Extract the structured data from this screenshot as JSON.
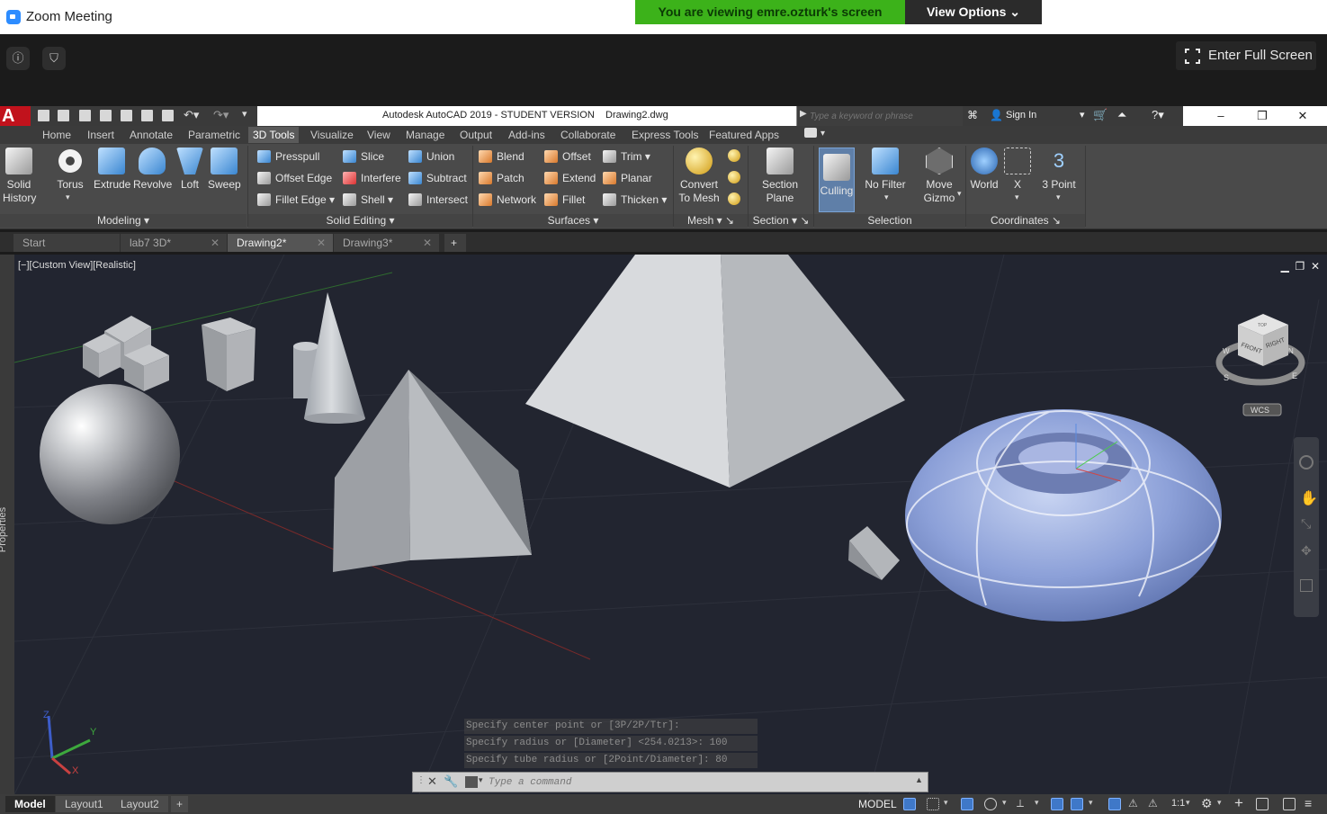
{
  "zoom": {
    "title": "Zoom Meeting",
    "banner": "You are viewing emre.ozturk's screen",
    "view_options": "View Options",
    "fullscreen": "Enter Full Screen"
  },
  "acad": {
    "logo": "A",
    "caption": "Autodesk AutoCAD 2019 - STUDENT VERSION    Drawing2.dwg",
    "search_placeholder": "Type a keyword or phrase",
    "sign_in": "Sign In"
  },
  "ribbon_tabs": [
    "Home",
    "Insert",
    "Annotate",
    "Parametric",
    "3D Tools",
    "Visualize",
    "View",
    "Manage",
    "Output",
    "Add-ins",
    "Collaborate",
    "Express Tools",
    "Featured Apps"
  ],
  "ribbon": {
    "modeling": {
      "title": "Modeling",
      "solid_history": "Solid\nHistory",
      "torus": "Torus",
      "extrude": "Extrude",
      "revolve": "Revolve",
      "loft": "Loft",
      "sweep": "Sweep"
    },
    "solid_editing": {
      "title": "Solid Editing",
      "presspull": "Presspull",
      "offset_edge": "Offset Edge",
      "fillet_edge": "Fillet Edge",
      "slice": "Slice",
      "interfere": "Interfere",
      "shell": "Shell",
      "union": "Union",
      "subtract": "Subtract",
      "intersect": "Intersect"
    },
    "surfaces": {
      "title": "Surfaces",
      "blend": "Blend",
      "patch": "Patch",
      "network": "Network",
      "offset": "Offset",
      "extend": "Extend",
      "fillet": "Fillet",
      "trim": "Trim",
      "planar": "Planar",
      "thicken": "Thicken"
    },
    "mesh": {
      "title": "Mesh",
      "convert": "Convert\nTo Mesh"
    },
    "section": {
      "title": "Section",
      "plane": "Section\nPlane"
    },
    "selection": {
      "title": "Selection",
      "culling": "Culling",
      "no_filter": "No Filter",
      "move_gizmo": "Move\nGizmo"
    },
    "coordinates": {
      "title": "Coordinates",
      "world": "World",
      "x": "X",
      "three_point": "3 Point"
    }
  },
  "file_tabs": [
    "Start",
    "lab7 3D*",
    "Drawing2*",
    "Drawing3*"
  ],
  "viewport": {
    "label": "[−][Custom View][Realistic]",
    "properties": "Properties",
    "viewcube": {
      "top": "TOP",
      "front": "FRONT",
      "right": "RIGHT",
      "wcs": "WCS",
      "n": "N",
      "w": "W",
      "s": "S",
      "e": "E"
    },
    "ucs": {
      "x": "X",
      "y": "Y",
      "z": "Z"
    }
  },
  "command": {
    "history": [
      "Specify center point or [3P/2P/Ttr]:",
      "Specify radius or [Diameter] <254.0213>: 100",
      "Specify tube radius or [2Point/Diameter]: 80"
    ],
    "placeholder": "Type a command"
  },
  "layout_tabs": [
    "Model",
    "Layout1",
    "Layout2"
  ],
  "status": {
    "model": "MODEL",
    "scale": "1:1"
  }
}
